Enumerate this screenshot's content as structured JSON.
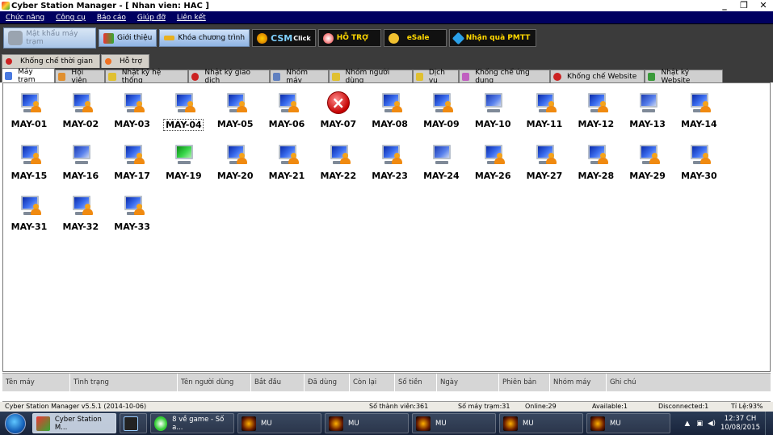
{
  "window": {
    "title": "Cyber Station Manager - [ Nhan vien: HAC ]",
    "controls": [
      "_",
      "❐",
      "✕"
    ]
  },
  "menu": [
    "Chức năng",
    "Công cụ",
    "Báo cáo",
    "Giúp đỡ",
    "Liên kết"
  ],
  "toolbar": {
    "pass_label": "Mật khẩu máy trạm",
    "intro_label": "Giới thiệu",
    "lock_label": "Khóa chương trình",
    "csm_label": "CSM",
    "csm_sub": "Click",
    "support_label": "HỖ TRỢ",
    "esale_label": "eSale",
    "gift_label": "Nhận quà PMTT"
  },
  "tabs_top": [
    "Khống chế thời gian",
    "Hỗ trợ"
  ],
  "tabs": [
    "Máy trạm",
    "Hội viên",
    "Nhật ký hệ thống",
    "Nhật ký giao dịch",
    "Nhóm máy",
    "Nhóm người dùng",
    "Dịch vụ",
    "Khống chế ứng dụng",
    "Khống chế Website",
    "Nhật ký Website"
  ],
  "machines": [
    {
      "name": "MAY-01",
      "state": "user"
    },
    {
      "name": "MAY-02",
      "state": "user"
    },
    {
      "name": "MAY-03",
      "state": "user"
    },
    {
      "name": "MAY-04",
      "state": "user",
      "selected": true
    },
    {
      "name": "MAY-05",
      "state": "user"
    },
    {
      "name": "MAY-06",
      "state": "user"
    },
    {
      "name": "MAY-07",
      "state": "error"
    },
    {
      "name": "MAY-08",
      "state": "user"
    },
    {
      "name": "MAY-09",
      "state": "user"
    },
    {
      "name": "MAY-10",
      "state": "idle"
    },
    {
      "name": "MAY-11",
      "state": "user"
    },
    {
      "name": "MAY-12",
      "state": "user"
    },
    {
      "name": "MAY-13",
      "state": "idle"
    },
    {
      "name": "MAY-14",
      "state": "user"
    },
    {
      "name": "MAY-15",
      "state": "user"
    },
    {
      "name": "MAY-16",
      "state": "idle"
    },
    {
      "name": "MAY-17",
      "state": "user"
    },
    {
      "name": "MAY-19",
      "state": "green"
    },
    {
      "name": "MAY-20",
      "state": "user"
    },
    {
      "name": "MAY-21",
      "state": "user"
    },
    {
      "name": "MAY-22",
      "state": "user"
    },
    {
      "name": "MAY-23",
      "state": "user"
    },
    {
      "name": "MAY-24",
      "state": "idle"
    },
    {
      "name": "MAY-26",
      "state": "user"
    },
    {
      "name": "MAY-27",
      "state": "user"
    },
    {
      "name": "MAY-28",
      "state": "user"
    },
    {
      "name": "MAY-29",
      "state": "user"
    },
    {
      "name": "MAY-30",
      "state": "user"
    },
    {
      "name": "MAY-31",
      "state": "user"
    },
    {
      "name": "MAY-32",
      "state": "user"
    },
    {
      "name": "MAY-33",
      "state": "user"
    }
  ],
  "grid_columns": [
    "Tên máy",
    "Tình trạng",
    "Tên người dùng",
    "Bắt đầu",
    "Đã dùng",
    "Còn lại",
    "Số tiền",
    "Ngày",
    "Phiên bản",
    "Nhóm máy",
    "Ghi chú"
  ],
  "status": {
    "version": "Cyber Station Manager v5.5.1 (2014-10-06)",
    "members": "Số thành viên:361",
    "stations": "Số máy trạm:31",
    "online": "Online:29",
    "available": "Available:1",
    "disconnected": "Disconnected:1",
    "ratio": "Tỉ Lệ:93%"
  },
  "taskbar": {
    "items": [
      "Cyber Station M...",
      "",
      "8 về game - Số a...",
      "MU",
      "MU",
      "MU",
      "MU",
      "MU"
    ],
    "time": "12:37 CH",
    "date": "10/08/2015"
  },
  "colors": {
    "menubar": "#000060",
    "toolbar_bg": "#3b3b3b"
  }
}
